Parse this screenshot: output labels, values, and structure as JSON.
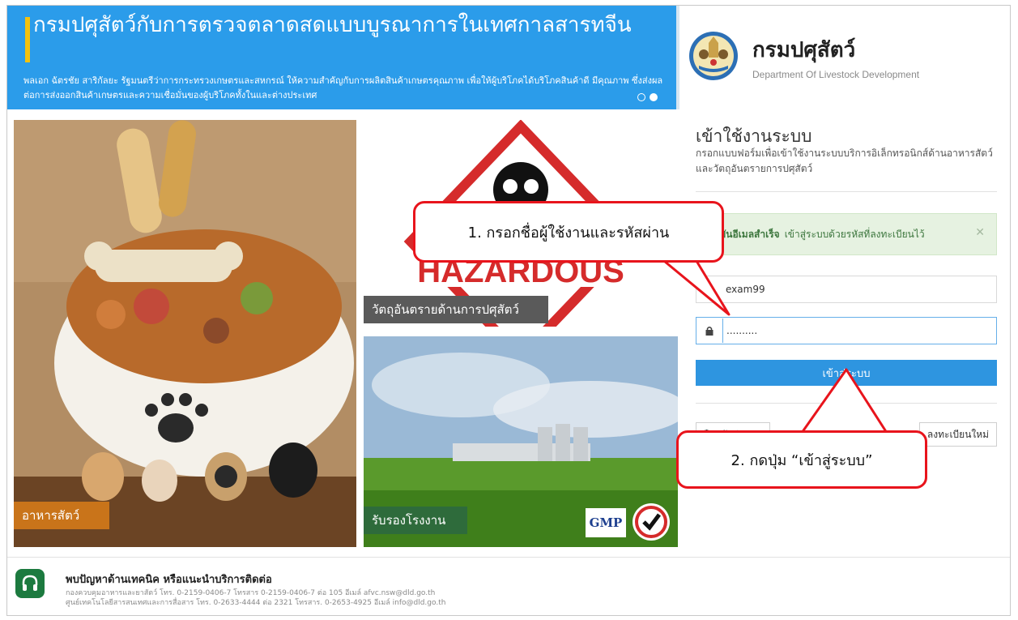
{
  "banner": {
    "title": "กรมปศุสัตว์กับการตรวจตลาดสดแบบบูรณาการในเทศกาลสารทจีน",
    "description": "พลเอก ฉัตรชัย สาริกัลยะ รัฐมนตรีว่าการกระทรวงเกษตรและสหกรณ์ ให้ความสำคัญกับการผลิตสินค้าเกษตรคุณภาพ เพื่อให้ผู้บริโภคได้บริโภคสินค้าดี มีคุณภาพ ซึ่งส่งผลต่อการส่งออกสินค้าเกษตรและความเชื่อมั่นของผู้บริโภคทั้งในและต่างประเทศ",
    "slide_count": 2,
    "active_slide": 2
  },
  "logo": {
    "title": "กรมปศุสัตว์",
    "subtitle": "Department Of Livestock Development"
  },
  "tiles": {
    "food_label": "อาหารสัตว์",
    "hazard_label": "วัตถุอันตรายด้านการปศุสัตว์",
    "hazard_sign_text": "HAZARDOUS",
    "factory_label": "รับรองโรงงาน",
    "gmp_text": "GMP"
  },
  "login": {
    "title": "เข้าใช้งานระบบ",
    "description": "กรอกแบบฟอร์มเพื่อเข้าใช้งานระบบบริการอิเล็กทรอนิกส์ด้านอาหารสัตว์และวัตถุอันตรายการปศุสัตว์",
    "alert_strong": "ยืนยันอีเมลสำเร็จ",
    "alert_text": "เข้าสู่ระบบด้วยรหัสที่ลงทะเบียนไว้",
    "username_value": "exam99",
    "password_value": "..........",
    "submit_label": "เข้าสู่ระบบ",
    "forgot_label": "ลืมรหัสผ่าน",
    "register_label": "ลงทะเบียนใหม่"
  },
  "callouts": {
    "step1": "1. กรอกชื่อผู้ใช้งานและรหัสผ่าน",
    "step2": "2. กดปุ่ม “เข้าสู่ระบบ”"
  },
  "footer": {
    "title": "พบปัญหาด้านเทคนิค หรือแนะนำบริการติดต่อ",
    "line1": "กองควบคุมอาหารและยาสัตว์ โทร. 0-2159-0406-7 โทรสาร 0-2159-0406-7 ต่อ 105 อีเมล์ afvc.nsw@dld.go.th",
    "line2": "ศูนย์เทคโนโลยีสารสนเทศและการสื่อสาร โทร. 0-2633-4444 ต่อ 2321 โทรสาร. 0-2653-4925 อีเมล์ info@dld.go.th"
  },
  "colors": {
    "banner_blue": "#2b9cea",
    "accent_yellow": "#f4c20d",
    "submit_blue": "#2e95e0",
    "callout_red": "#e8141c",
    "alert_green_bg": "#e6f2e1",
    "footer_green": "#1c7a3f"
  }
}
